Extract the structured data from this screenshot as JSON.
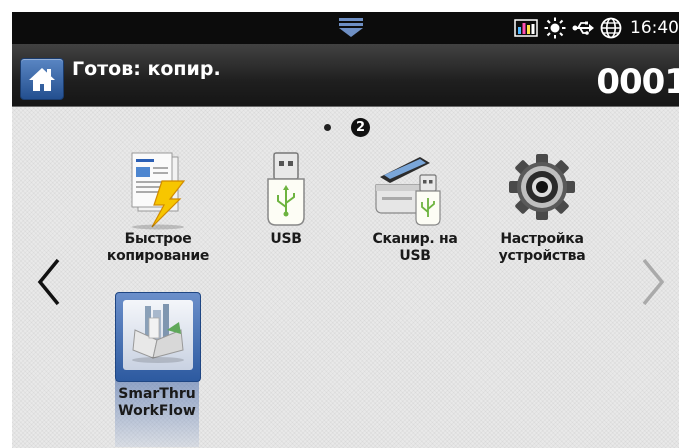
{
  "status_bar": {
    "time": "16:40",
    "icons": [
      "toner-level-icon",
      "sun-eco-icon",
      "usb-connection-icon",
      "network-globe-icon"
    ]
  },
  "header": {
    "title": "Готов: копир.",
    "counter": "0001"
  },
  "pager": {
    "current_page": "2",
    "total_pages": 2
  },
  "apps": [
    {
      "label_line1": "Быстрое",
      "label_line2": "копирование",
      "icon": "quick-copy-icon"
    },
    {
      "label_line1": "USB",
      "label_line2": "",
      "icon": "usb-drive-icon"
    },
    {
      "label_line1": "Сканир. на USB",
      "label_line2": "",
      "icon": "scan-to-usb-icon"
    },
    {
      "label_line1": "Настройка",
      "label_line2": "устройства",
      "icon": "settings-gear-icon"
    },
    {
      "label_line1": "SmarThru",
      "label_line2": "WorkFlow",
      "icon": "smarthru-workflow-icon",
      "selected": true
    }
  ],
  "colors": {
    "title_bar": "#1f1f1f",
    "status_bar": "#0c0c0c",
    "home_button": "#2d5aa0",
    "selected_tile": "#3b66ad",
    "background": "#e9e9e9"
  }
}
